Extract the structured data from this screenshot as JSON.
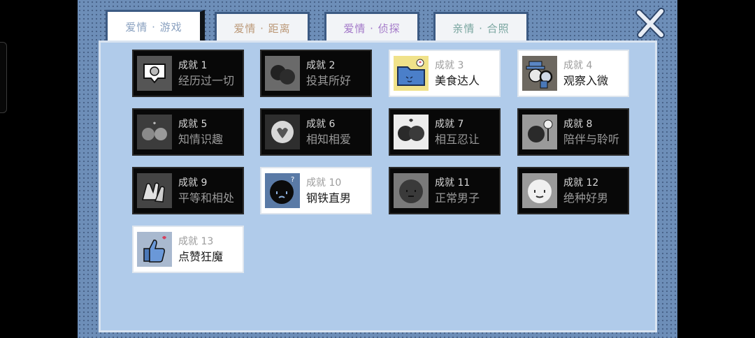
{
  "tabs": [
    {
      "label": "爱情 · 游戏",
      "active": true
    },
    {
      "label": "爱情 · 距离",
      "active": false
    },
    {
      "label": "爱情 · 侦探",
      "active": false
    },
    {
      "label": "亲情 · 合照",
      "active": false
    }
  ],
  "close": {
    "icon": "close-x-icon"
  },
  "achievements": [
    {
      "num": "成就 1",
      "name": "经历过一切",
      "unlocked": false,
      "icon": "speech-bubble-face-icon"
    },
    {
      "num": "成就 2",
      "name": "投其所好",
      "unlocked": false,
      "icon": "two-heads-icon"
    },
    {
      "num": "成就 3",
      "name": "美食达人",
      "unlocked": true,
      "icon": "blue-folder-face-icon"
    },
    {
      "num": "成就 4",
      "name": "观察入微",
      "unlocked": true,
      "icon": "detective-magnifier-icon"
    },
    {
      "num": "成就 5",
      "name": "知情识趣",
      "unlocked": false,
      "icon": "couple-heart-icon"
    },
    {
      "num": "成就 6",
      "name": "相知相爱",
      "unlocked": false,
      "icon": "heart-flower-icon"
    },
    {
      "num": "成就 7",
      "name": "相互忍让",
      "unlocked": false,
      "icon": "two-faces-heart-icon"
    },
    {
      "num": "成就 8",
      "name": "陪伴与聆听",
      "unlocked": false,
      "icon": "face-flower-icon"
    },
    {
      "num": "成就 9",
      "name": "平等和相处",
      "unlocked": false,
      "icon": "clapping-hands-icon"
    },
    {
      "num": "成就 10",
      "name": "钢铁直男",
      "unlocked": true,
      "icon": "confused-dark-face-icon"
    },
    {
      "num": "成就 11",
      "name": "正常男子",
      "unlocked": false,
      "icon": "gray-face-icon"
    },
    {
      "num": "成就 12",
      "name": "绝种好男",
      "unlocked": false,
      "icon": "white-face-icon"
    },
    {
      "num": "成就 13",
      "name": "点赞狂魔",
      "unlocked": true,
      "icon": "thumbs-up-heart-icon"
    }
  ]
}
